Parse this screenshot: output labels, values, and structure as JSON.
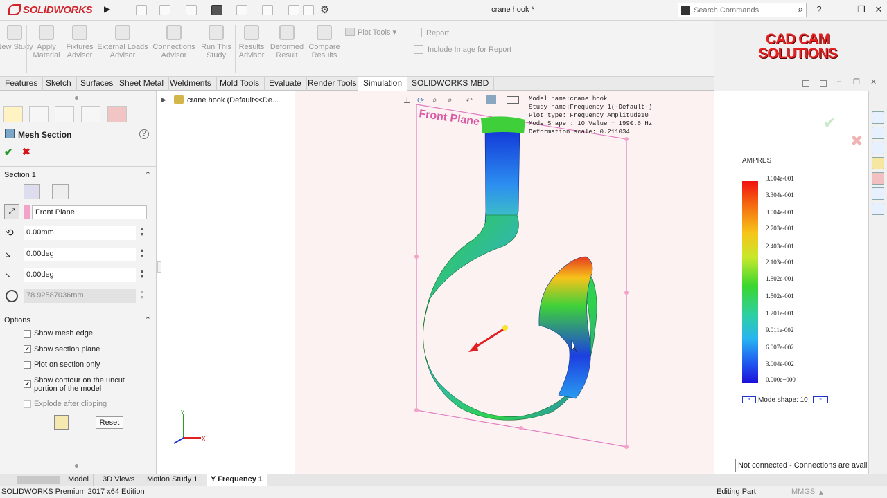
{
  "app": {
    "name": "SOLIDWORKS",
    "document_title": "crane hook *"
  },
  "search": {
    "placeholder": "Search Commands"
  },
  "window": {
    "help": "?",
    "minimize": "–",
    "restore": "❐",
    "close": "✕"
  },
  "ribbon": {
    "buttons": [
      "New Study",
      "Apply Material",
      "Fixtures Advisor",
      "External Loads Advisor",
      "Connections Advisor",
      "Run This Study",
      "Results Advisor",
      "Deformed Result",
      "Compare Results"
    ],
    "plot_tools": "Plot Tools",
    "report": "Report",
    "include_image": "Include Image for Report"
  },
  "brand": {
    "line1": "CAD CAM",
    "line2": "SOLUTIONS"
  },
  "tabs": [
    "Features",
    "Sketch",
    "Surfaces",
    "Sheet Metal",
    "Weldments",
    "Mold Tools",
    "Evaluate",
    "Render Tools",
    "Simulation",
    "SOLIDWORKS MBD"
  ],
  "active_tab": "Simulation",
  "property_manager": {
    "title": "Mesh Section",
    "section1": {
      "label": "Section 1",
      "plane": "Front Plane",
      "offset": "0.00mm",
      "angle_x": "0.00deg",
      "angle_y": "0.00deg",
      "radius": "78.92587036mm"
    },
    "options": {
      "label": "Options",
      "items": [
        {
          "label": "Show mesh edge",
          "checked": false
        },
        {
          "label": "Show section plane",
          "checked": true
        },
        {
          "label": "Plot on section only",
          "checked": false
        },
        {
          "label": "Show contour on the uncut portion of the model",
          "checked": true
        },
        {
          "label": "Explode after clipping",
          "checked": false,
          "disabled": true
        }
      ]
    },
    "reset": "Reset"
  },
  "tree": {
    "root": "crane hook  (Default<<De..."
  },
  "viewport": {
    "plane_label": "Front Plane",
    "info": [
      "Model name:crane hook",
      "Study name:Frequency 1(-Default-)",
      "Plot type: Frequency Amplitude10",
      "Mode Shape : 10  Value =     1990.6 Hz",
      "Deformation scale: 0.211034"
    ],
    "axes": {
      "x": "X",
      "y": "Y"
    }
  },
  "legend": {
    "title": "AMPRES",
    "ticks": [
      "3.604e-001",
      "3.304e-001",
      "3.004e-001",
      "2.703e-001",
      "2.403e-001",
      "2.103e-001",
      "1.802e-001",
      "1.502e-001",
      "1.201e-001",
      "9.011e-002",
      "6.007e-002",
      "3.004e-002",
      "0.000e+000"
    ],
    "mode_shape": "Mode shape: 10"
  },
  "bottom_tabs": [
    "Model",
    "3D Views",
    "Motion Study 1",
    "Frequency 1"
  ],
  "active_bottom_tab": "Frequency 1",
  "status": {
    "edition": "SOLIDWORKS Premium 2017 x64 Edition",
    "editing": "Editing Part",
    "units": "MMGS",
    "tooltip": "Not connected - Connections are available"
  },
  "colors": {
    "accent_red": "#d2232a",
    "plane_magenta": "#d95aa5",
    "ok_green": "#1f9a2a"
  }
}
